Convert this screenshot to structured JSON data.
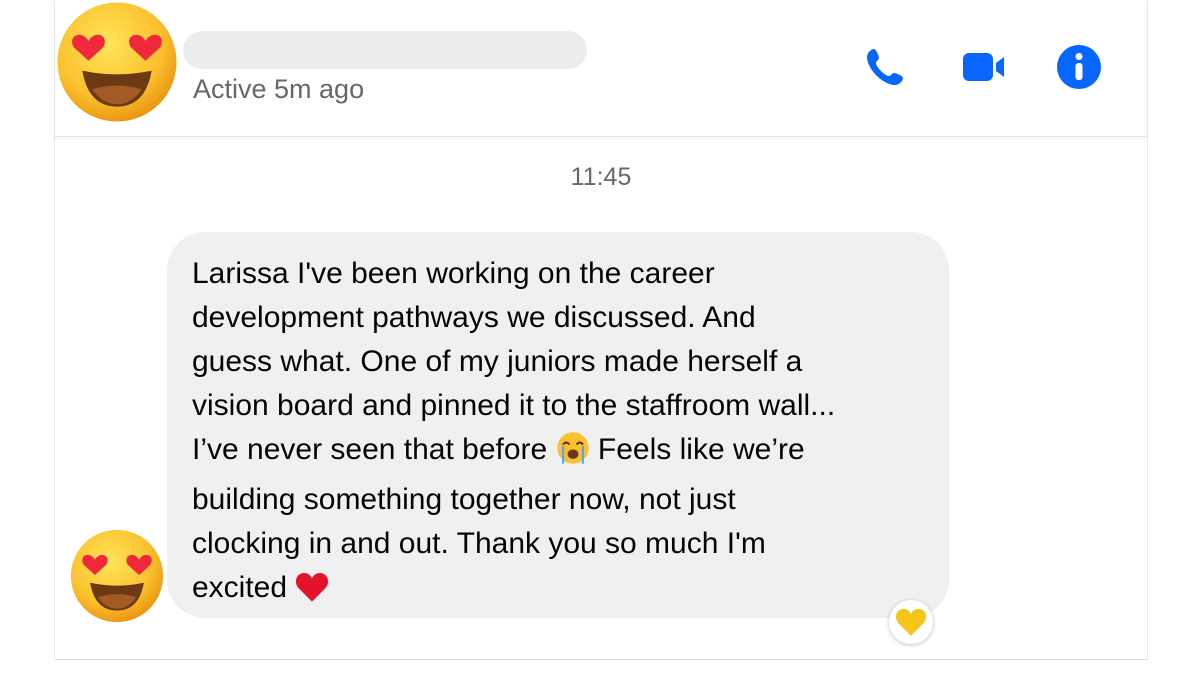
{
  "header": {
    "avatar_emoji": "smiling-face-with-heart-eyes",
    "status": "Active 5m ago",
    "actions": [
      {
        "name": "audio-call",
        "icon": "phone-icon"
      },
      {
        "name": "video-call",
        "icon": "video-camera-icon"
      },
      {
        "name": "info",
        "icon": "info-icon"
      }
    ]
  },
  "conversation": {
    "timestamp": "11:45",
    "messages": [
      {
        "sender_avatar_emoji": "smiling-face-with-heart-eyes",
        "lines": [
          "Larissa I've been working on the career",
          "development pathways we discussed. And",
          "guess what. One of my juniors made herself a",
          "vision board and pinned it to the staffroom wall...",
          "I’ve never seen that before",
          "Feels like we’re",
          "building something together now, not just",
          "clocking in and out. Thank you so much I'm",
          "excited"
        ],
        "inline_emojis": [
          "loudly-crying-face",
          "red-heart"
        ],
        "reaction_emoji": "yellow-heart"
      }
    ]
  },
  "colors": {
    "accent": "#0866ff",
    "bubble": "#f0f0f0",
    "secondary_text": "#65676b",
    "primary_text": "#050505"
  }
}
